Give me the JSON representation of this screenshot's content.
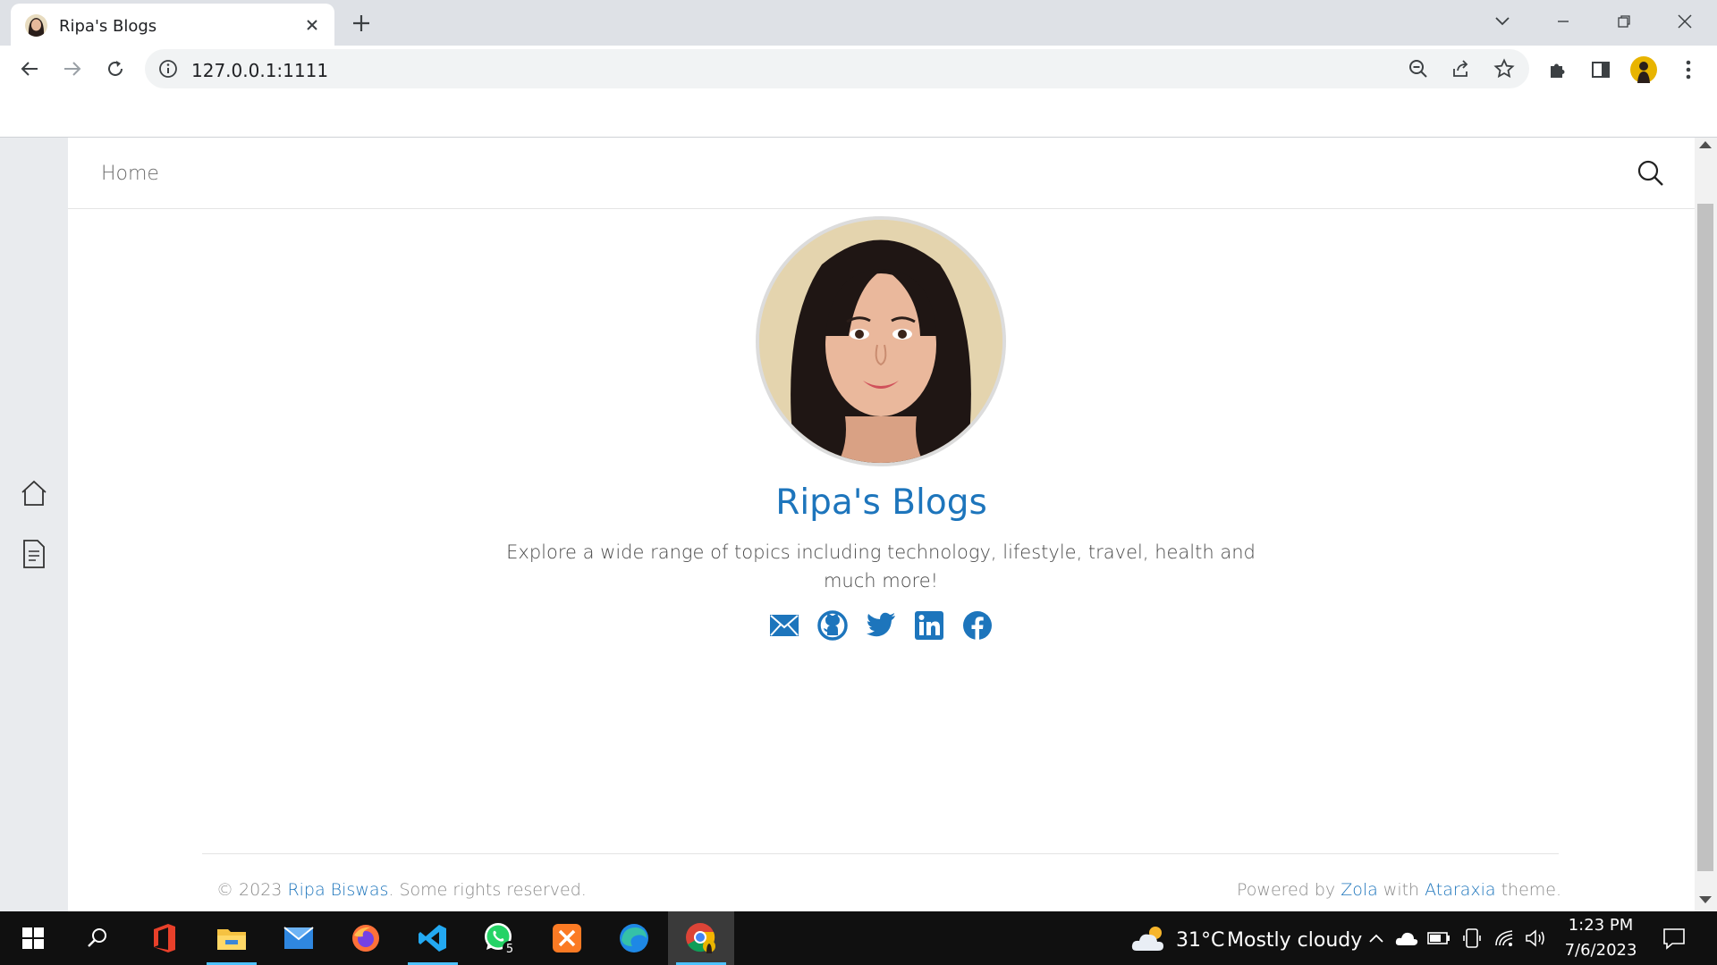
{
  "browser": {
    "tab_title": "Ripa's Blogs",
    "url": "127.0.0.1:1111",
    "new_tab_symbol": "+",
    "tab_close_symbol": "×"
  },
  "site": {
    "nav_home": "Home",
    "title": "Ripa's Blogs",
    "description": "Explore a wide range of topics including technology, lifestyle, travel, health and much more!",
    "social_links": [
      "email-icon",
      "github-icon",
      "twitter-icon",
      "linkedin-icon",
      "facebook-icon"
    ],
    "sidebar_icons": [
      "home-icon",
      "document-icon"
    ],
    "footer": {
      "copyright_prefix": "© 2023 ",
      "author": "Ripa Biswas",
      "copyright_suffix": ". Some rights reserved.",
      "powered_prefix": "Powered by ",
      "engine": "Zola",
      "powered_mid": " with ",
      "theme": "Ataraxia",
      "powered_suffix": " theme."
    },
    "accent_color": "#1d75bc"
  },
  "taskbar": {
    "apps": [
      "windows-start-icon",
      "search-icon",
      "office-icon",
      "file-explorer-icon",
      "mail-icon",
      "firefox-icon",
      "vscode-icon",
      "whatsapp-icon",
      "xampp-icon",
      "edge-icon",
      "chrome-icon"
    ],
    "whatsapp_badge": "5",
    "weather_temp": "31°C",
    "weather_desc": "Mostly cloudy",
    "time": "1:23 PM",
    "date": "7/6/2023"
  }
}
